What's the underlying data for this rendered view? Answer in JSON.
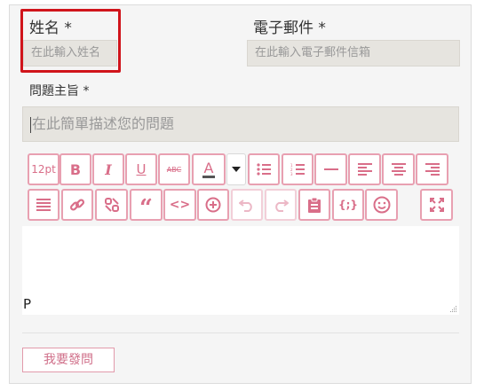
{
  "form": {
    "name_label": "姓名 *",
    "name_placeholder": "在此輸入姓名",
    "email_label": "電子郵件 *",
    "email_placeholder": "在此輸入電子郵件信箱",
    "subject_label": "問題主旨 *",
    "subject_placeholder": "在此簡單描述您的問題",
    "submit_label": "我要發問"
  },
  "toolbar": {
    "font_size": "12pt",
    "bold": "B",
    "italic": "I",
    "underline": "U",
    "strikethrough": "ABC",
    "font_color": "A",
    "blockquote": "“",
    "code": "<>",
    "insert_code": "{;}"
  },
  "editor": {
    "content": "P"
  },
  "colors": {
    "accent": "#d96e89",
    "button_border": "#e8a0b1",
    "highlight": "#d0141b",
    "input_bg": "#e6e4df"
  }
}
